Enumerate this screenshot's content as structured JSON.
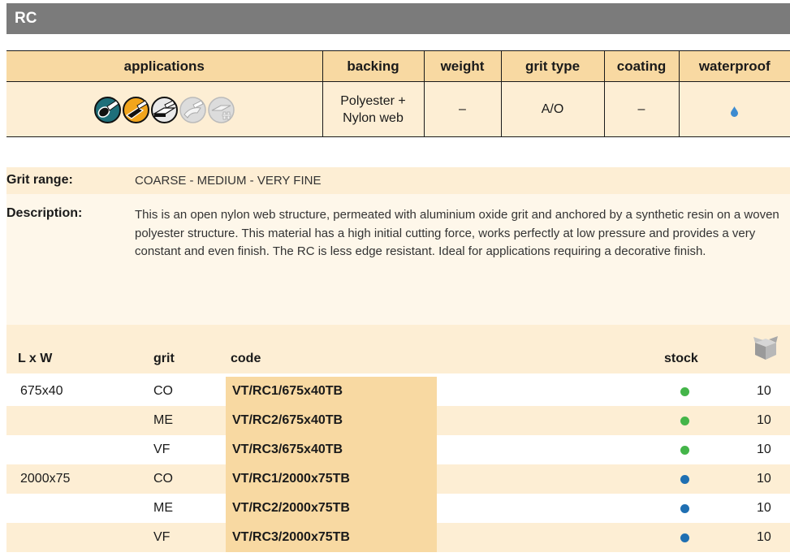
{
  "title": "RC",
  "spec": {
    "headers": [
      "applications",
      "backing",
      "weight",
      "grit type",
      "coating",
      "waterproof"
    ],
    "backing_line1": "Polyester +",
    "backing_line2": "Nylon web",
    "weight": "–",
    "grit_type": "A/O",
    "coating": "–",
    "waterproof_icon": "water-drop-icon",
    "application_icons": [
      "tube-icon",
      "flat-bar-icon",
      "profile-icon",
      "curve-icon",
      "structure-icon"
    ]
  },
  "grit_range": {
    "label": "Grit range:",
    "value": "COARSE - MEDIUM - VERY FINE"
  },
  "description": {
    "label": "Description:",
    "text": "This is an open nylon web structure, permeated with aluminium oxide grit and anchored by a synthetic resin on a woven polyester structure. This material has a high initial cutting force, works perfectly at low pressure and provides a very constant and even finish. The RC is less edge resistant. Ideal for applications requiring a decorative finish."
  },
  "products": {
    "headers": {
      "size": "L x W",
      "grit": "grit",
      "code": "code",
      "stock": "stock"
    },
    "box_icon": "box-icon",
    "rows": [
      {
        "size": "675x40",
        "grit": "CO",
        "code": "VT/RC1/675x40TB",
        "stock_color": "#44b549",
        "qty": "10"
      },
      {
        "size": "",
        "grit": "ME",
        "code": "VT/RC2/675x40TB",
        "stock_color": "#44b549",
        "qty": "10"
      },
      {
        "size": "",
        "grit": "VF",
        "code": "VT/RC3/675x40TB",
        "stock_color": "#44b549",
        "qty": "10"
      },
      {
        "size": "2000x75",
        "grit": "CO",
        "code": "VT/RC1/2000x75TB",
        "stock_color": "#1f6fb2",
        "qty": "10"
      },
      {
        "size": "",
        "grit": "ME",
        "code": "VT/RC2/2000x75TB",
        "stock_color": "#1f6fb2",
        "qty": "10"
      },
      {
        "size": "",
        "grit": "VF",
        "code": "VT/RC3/2000x75TB",
        "stock_color": "#1f6fb2",
        "qty": "10"
      }
    ]
  },
  "colors": {
    "header_bar": "#7b7b7b",
    "accent": "#f8d9a2",
    "light": "#fdeed4"
  }
}
